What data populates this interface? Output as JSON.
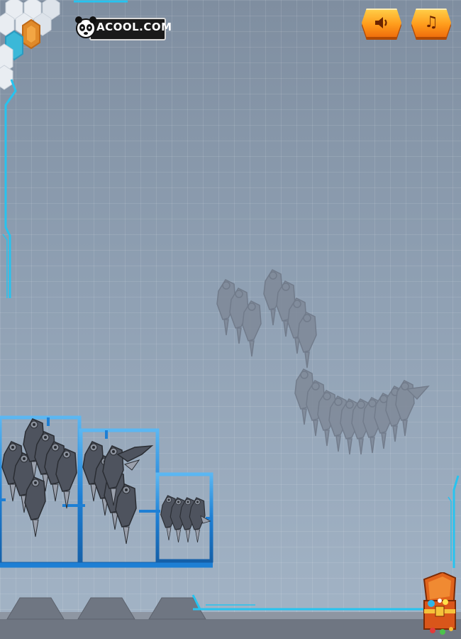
{
  "logo": {
    "text": "ACOOL.COM"
  },
  "buttons": {
    "sound_icon": "speaker-icon",
    "music_icon": "music-note-icon",
    "sound_glyph": "🔈",
    "music_glyph": "♫"
  },
  "colors": {
    "accent_cyan": "#27c3ef",
    "frame_blue": "#1e7fd4",
    "button_orange": "#ff9d1c",
    "part_gray": "#5a5f6a"
  },
  "parts": {
    "skeleton_silhouette": "robot-dinosaur-outline",
    "tray_parts": [
      "claw-cluster-left",
      "claw-cluster-middle",
      "spine-segment-small"
    ]
  }
}
